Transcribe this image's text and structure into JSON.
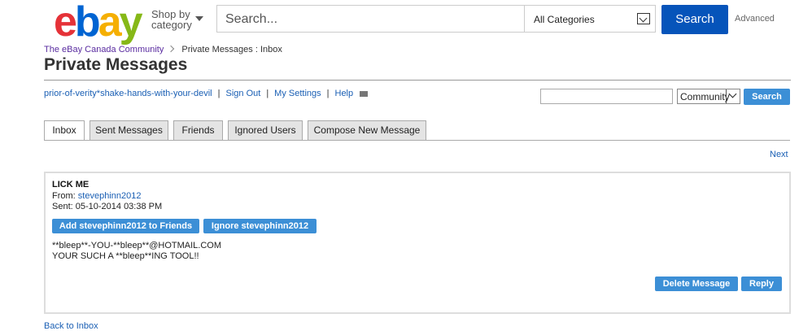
{
  "header": {
    "logo": {
      "e": "e",
      "b": "b",
      "a": "a",
      "y": "y"
    },
    "shop_by": [
      "Shop by",
      "category"
    ],
    "search_placeholder": "Search...",
    "category_select": "All Categories",
    "search_button": "Search",
    "advanced_link": "Advanced"
  },
  "breadcrumb": {
    "community": "The eBay Canada Community",
    "current": "Private Messages : Inbox"
  },
  "page_title": "Private Messages",
  "user_links": {
    "username": "prior-of-verity*shake-hands-with-your-devil",
    "sign_out": "Sign Out",
    "my_settings": "My Settings",
    "help": "Help",
    "sep": "|"
  },
  "community_search": {
    "value": "",
    "scope": "Community",
    "button": "Search"
  },
  "tabs": [
    "Inbox",
    "Sent Messages",
    "Friends",
    "Ignored Users",
    "Compose New Message"
  ],
  "pager": {
    "next": "Next"
  },
  "message": {
    "subject": "LICK ME",
    "from_label": "From:",
    "from_user": "stevephinn2012",
    "sent": "Sent: 05-10-2014 03:38 PM",
    "add_friend_button": "Add stevephinn2012 to Friends",
    "ignore_button": "Ignore stevephinn2012",
    "body_line1": "**bleep**-YOU-**bleep**@HOTMAIL.COM",
    "body_line2": "YOUR SUCH A **bleep**ING TOOL!!",
    "delete_button": "Delete Message",
    "reply_button": "Reply"
  },
  "back_to_inbox": "Back to Inbox",
  "colors": {
    "brand_blue": "#0654ba",
    "button_blue": "#3c8fd6",
    "link_blue": "#1a5fb4"
  }
}
